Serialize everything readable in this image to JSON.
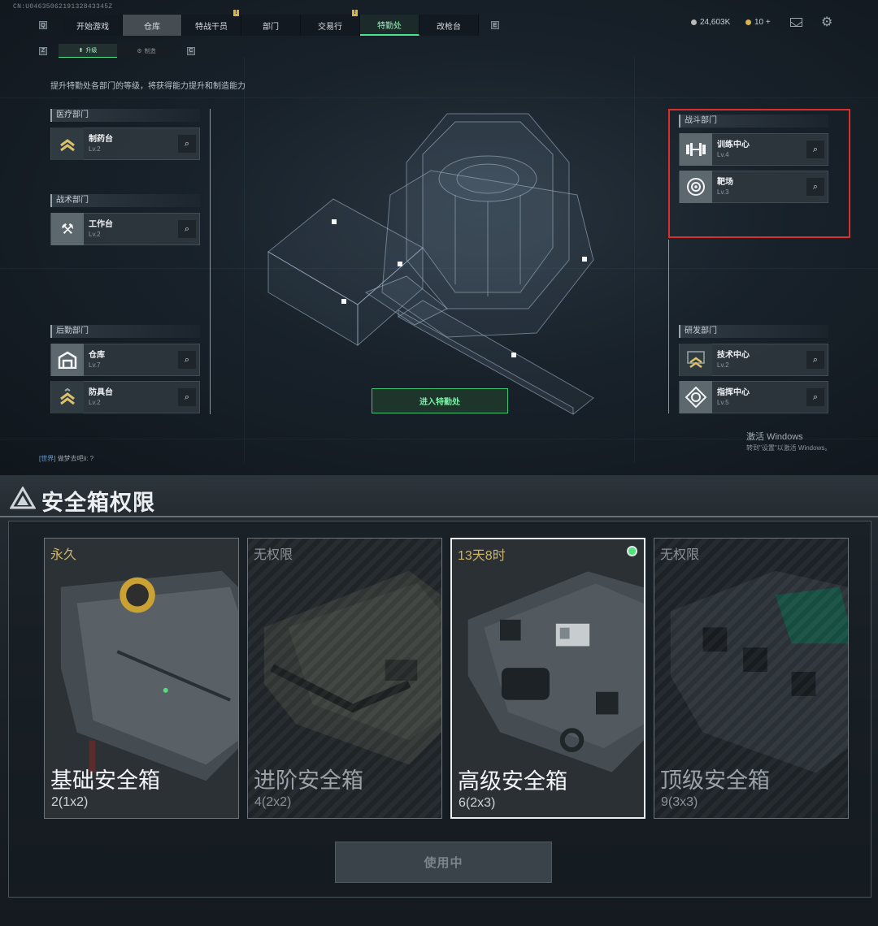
{
  "header": {
    "uid": "CN:U0463506219132843345Z",
    "tabs": [
      {
        "label": "开始游戏",
        "state": "normal",
        "badge": ""
      },
      {
        "label": "仓库",
        "state": "selected",
        "badge": ""
      },
      {
        "label": "特战干员",
        "state": "normal",
        "badge": "!"
      },
      {
        "label": "部门",
        "state": "normal",
        "badge": ""
      },
      {
        "label": "交易行",
        "state": "normal",
        "badge": "!"
      },
      {
        "label": "特勤处",
        "state": "active",
        "badge": ""
      },
      {
        "label": "改枪台",
        "state": "normal",
        "badge": ""
      }
    ],
    "nav_left_key": "Q",
    "nav_right_key": "E",
    "currency_silver": "24,603K",
    "currency_gold": "10 +"
  },
  "subtabs": {
    "left_key": "Z",
    "right_key": "C",
    "items": [
      {
        "label": "升级",
        "active": true
      },
      {
        "label": "制造",
        "active": false
      }
    ]
  },
  "description": "提升特勤处各部门的等级，将获得能力提升和制造能力",
  "departments": {
    "medical": {
      "title": "医疗部门",
      "items": [
        {
          "name": "制药台",
          "level": "Lv.2"
        }
      ]
    },
    "tactical": {
      "title": "战术部门",
      "items": [
        {
          "name": "工作台",
          "level": "Lv.2"
        }
      ]
    },
    "logistics": {
      "title": "后勤部门",
      "items": [
        {
          "name": "仓库",
          "level": "Lv.7"
        },
        {
          "name": "防具台",
          "level": "Lv.2"
        }
      ]
    },
    "combat": {
      "title": "战斗部门",
      "items": [
        {
          "name": "训练中心",
          "level": "Lv.4"
        },
        {
          "name": "靶场",
          "level": "Lv.3"
        }
      ]
    },
    "research": {
      "title": "研发部门",
      "items": [
        {
          "name": "技术中心",
          "level": "Lv.2"
        },
        {
          "name": "指挥中心",
          "level": "Lv.5"
        }
      ]
    }
  },
  "enter_button": "进入特勤处",
  "windows_watermark": {
    "line1": "激活 Windows",
    "line2": "转到\"设置\"以激活 Windows。"
  },
  "chat": {
    "channel": "[世界]",
    "message": "做梦去吧ii: ?"
  },
  "safebox": {
    "title": "安全箱权限",
    "boxes": [
      {
        "tag": "永久",
        "name": "基础安全箱",
        "capacity": "2(1x2)",
        "available": true,
        "selected": false
      },
      {
        "tag": "无权限",
        "name": "进阶安全箱",
        "capacity": "4(2x2)",
        "available": false,
        "selected": false
      },
      {
        "tag": "13天8时",
        "name": "高级安全箱",
        "capacity": "6(2x3)",
        "available": true,
        "selected": true
      },
      {
        "tag": "无权限",
        "name": "顶级安全箱",
        "capacity": "9(3x3)",
        "available": false,
        "selected": false
      }
    ],
    "use_button": "使用中"
  }
}
